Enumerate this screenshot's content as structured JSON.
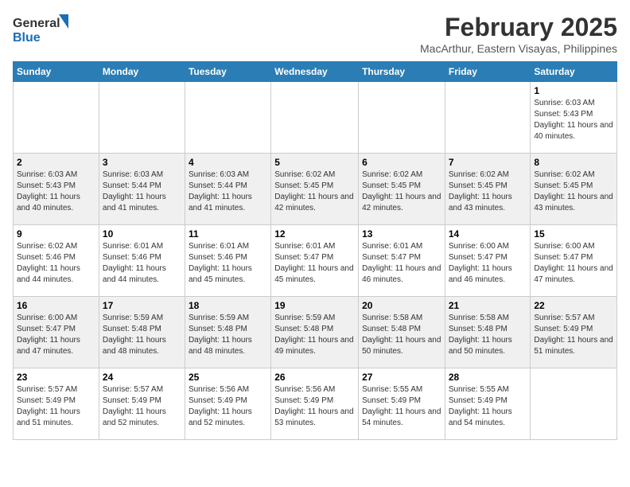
{
  "header": {
    "logo_general": "General",
    "logo_blue": "Blue",
    "month": "February 2025",
    "location": "MacArthur, Eastern Visayas, Philippines"
  },
  "days_of_week": [
    "Sunday",
    "Monday",
    "Tuesday",
    "Wednesday",
    "Thursday",
    "Friday",
    "Saturday"
  ],
  "weeks": [
    [
      {
        "day": "",
        "info": ""
      },
      {
        "day": "",
        "info": ""
      },
      {
        "day": "",
        "info": ""
      },
      {
        "day": "",
        "info": ""
      },
      {
        "day": "",
        "info": ""
      },
      {
        "day": "",
        "info": ""
      },
      {
        "day": "1",
        "info": "Sunrise: 6:03 AM\nSunset: 5:43 PM\nDaylight: 11 hours and 40 minutes."
      }
    ],
    [
      {
        "day": "2",
        "info": "Sunrise: 6:03 AM\nSunset: 5:43 PM\nDaylight: 11 hours and 40 minutes."
      },
      {
        "day": "3",
        "info": "Sunrise: 6:03 AM\nSunset: 5:44 PM\nDaylight: 11 hours and 41 minutes."
      },
      {
        "day": "4",
        "info": "Sunrise: 6:03 AM\nSunset: 5:44 PM\nDaylight: 11 hours and 41 minutes."
      },
      {
        "day": "5",
        "info": "Sunrise: 6:02 AM\nSunset: 5:45 PM\nDaylight: 11 hours and 42 minutes."
      },
      {
        "day": "6",
        "info": "Sunrise: 6:02 AM\nSunset: 5:45 PM\nDaylight: 11 hours and 42 minutes."
      },
      {
        "day": "7",
        "info": "Sunrise: 6:02 AM\nSunset: 5:45 PM\nDaylight: 11 hours and 43 minutes."
      },
      {
        "day": "8",
        "info": "Sunrise: 6:02 AM\nSunset: 5:45 PM\nDaylight: 11 hours and 43 minutes."
      }
    ],
    [
      {
        "day": "9",
        "info": "Sunrise: 6:02 AM\nSunset: 5:46 PM\nDaylight: 11 hours and 44 minutes."
      },
      {
        "day": "10",
        "info": "Sunrise: 6:01 AM\nSunset: 5:46 PM\nDaylight: 11 hours and 44 minutes."
      },
      {
        "day": "11",
        "info": "Sunrise: 6:01 AM\nSunset: 5:46 PM\nDaylight: 11 hours and 45 minutes."
      },
      {
        "day": "12",
        "info": "Sunrise: 6:01 AM\nSunset: 5:47 PM\nDaylight: 11 hours and 45 minutes."
      },
      {
        "day": "13",
        "info": "Sunrise: 6:01 AM\nSunset: 5:47 PM\nDaylight: 11 hours and 46 minutes."
      },
      {
        "day": "14",
        "info": "Sunrise: 6:00 AM\nSunset: 5:47 PM\nDaylight: 11 hours and 46 minutes."
      },
      {
        "day": "15",
        "info": "Sunrise: 6:00 AM\nSunset: 5:47 PM\nDaylight: 11 hours and 47 minutes."
      }
    ],
    [
      {
        "day": "16",
        "info": "Sunrise: 6:00 AM\nSunset: 5:47 PM\nDaylight: 11 hours and 47 minutes."
      },
      {
        "day": "17",
        "info": "Sunrise: 5:59 AM\nSunset: 5:48 PM\nDaylight: 11 hours and 48 minutes."
      },
      {
        "day": "18",
        "info": "Sunrise: 5:59 AM\nSunset: 5:48 PM\nDaylight: 11 hours and 48 minutes."
      },
      {
        "day": "19",
        "info": "Sunrise: 5:59 AM\nSunset: 5:48 PM\nDaylight: 11 hours and 49 minutes."
      },
      {
        "day": "20",
        "info": "Sunrise: 5:58 AM\nSunset: 5:48 PM\nDaylight: 11 hours and 50 minutes."
      },
      {
        "day": "21",
        "info": "Sunrise: 5:58 AM\nSunset: 5:48 PM\nDaylight: 11 hours and 50 minutes."
      },
      {
        "day": "22",
        "info": "Sunrise: 5:57 AM\nSunset: 5:49 PM\nDaylight: 11 hours and 51 minutes."
      }
    ],
    [
      {
        "day": "23",
        "info": "Sunrise: 5:57 AM\nSunset: 5:49 PM\nDaylight: 11 hours and 51 minutes."
      },
      {
        "day": "24",
        "info": "Sunrise: 5:57 AM\nSunset: 5:49 PM\nDaylight: 11 hours and 52 minutes."
      },
      {
        "day": "25",
        "info": "Sunrise: 5:56 AM\nSunset: 5:49 PM\nDaylight: 11 hours and 52 minutes."
      },
      {
        "day": "26",
        "info": "Sunrise: 5:56 AM\nSunset: 5:49 PM\nDaylight: 11 hours and 53 minutes."
      },
      {
        "day": "27",
        "info": "Sunrise: 5:55 AM\nSunset: 5:49 PM\nDaylight: 11 hours and 54 minutes."
      },
      {
        "day": "28",
        "info": "Sunrise: 5:55 AM\nSunset: 5:49 PM\nDaylight: 11 hours and 54 minutes."
      },
      {
        "day": "",
        "info": ""
      }
    ]
  ]
}
